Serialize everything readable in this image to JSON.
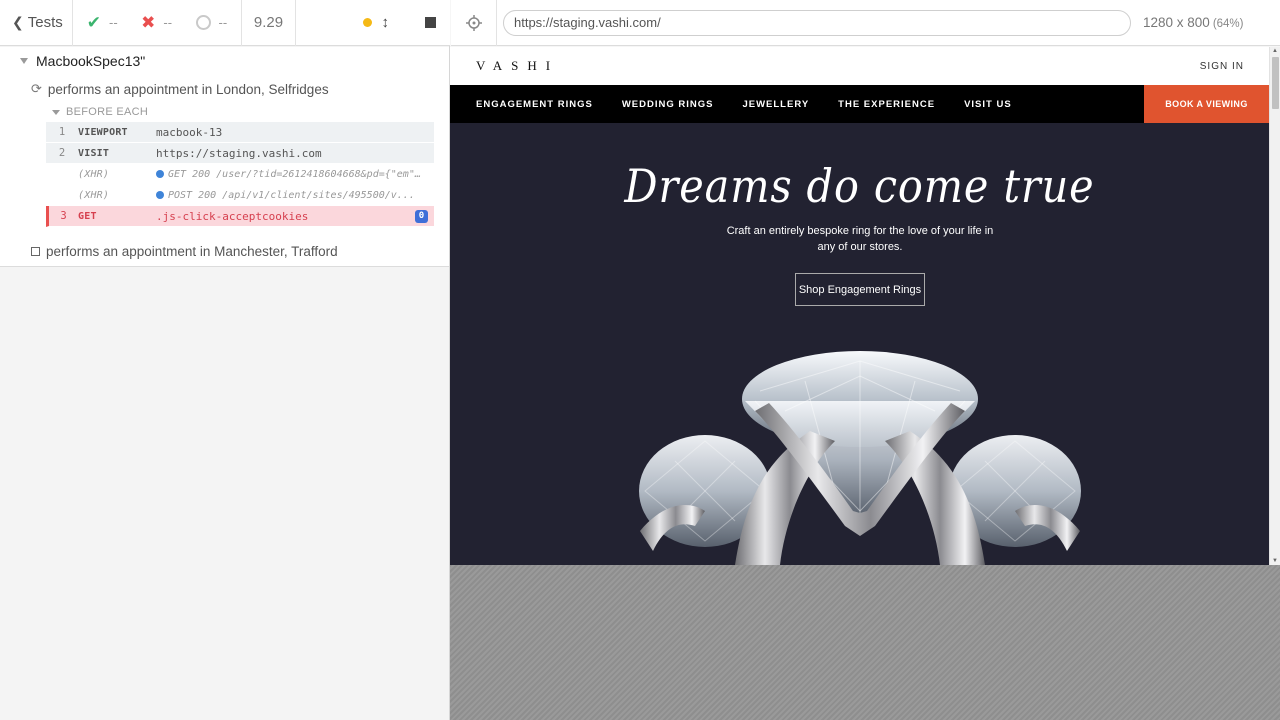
{
  "reporter": {
    "back_label": "Tests",
    "stats": {
      "passed": "--",
      "failed": "--",
      "pending": "--"
    },
    "duration": "9.29",
    "suite": {
      "title": "MacbookSpec13\""
    },
    "tests": [
      {
        "title": "performs an appointment in London, Selfridges",
        "state": "running"
      },
      {
        "title": "performs an appointment in Manchester, Trafford",
        "state": "pending"
      }
    ],
    "hook_title": "BEFORE EACH",
    "commands": [
      {
        "num": "1",
        "name": "VIEWPORT",
        "message": "macbook-13"
      },
      {
        "num": "2",
        "name": "VISIT",
        "message": "https://staging.vashi.com"
      },
      {
        "num": "",
        "name": "(XHR)",
        "message": "GET 200 /user/?tid=2612418604668&pd={\"em\":\"24..."
      },
      {
        "num": "",
        "name": "(XHR)",
        "message": "POST 200 /api/v1/client/sites/495500/v..."
      },
      {
        "num": "3",
        "name": "GET",
        "message": ".js-click-acceptcookies",
        "badge": "0"
      }
    ]
  },
  "aut": {
    "url": "https://staging.vashi.com/",
    "viewport": "1280 x 800",
    "scale": "(64%)"
  },
  "site": {
    "logo": "VASHI",
    "signin": "SIGN IN",
    "nav": [
      "ENGAGEMENT RINGS",
      "WEDDING RINGS",
      "JEWELLERY",
      "THE EXPERIENCE",
      "VISIT US"
    ],
    "book_button": "BOOK A VIEWING",
    "hero_title": "Dreams do come true",
    "hero_subtitle": "Craft an entirely bespoke ring for the love of your life in any of our stores.",
    "hero_cta": "Shop Engagement Rings"
  },
  "colors": {
    "pass": "#3bb46e",
    "fail": "#e94f4f",
    "running": "#f5b916",
    "book_button": "#e0542f",
    "hero_bg": "#222231"
  }
}
